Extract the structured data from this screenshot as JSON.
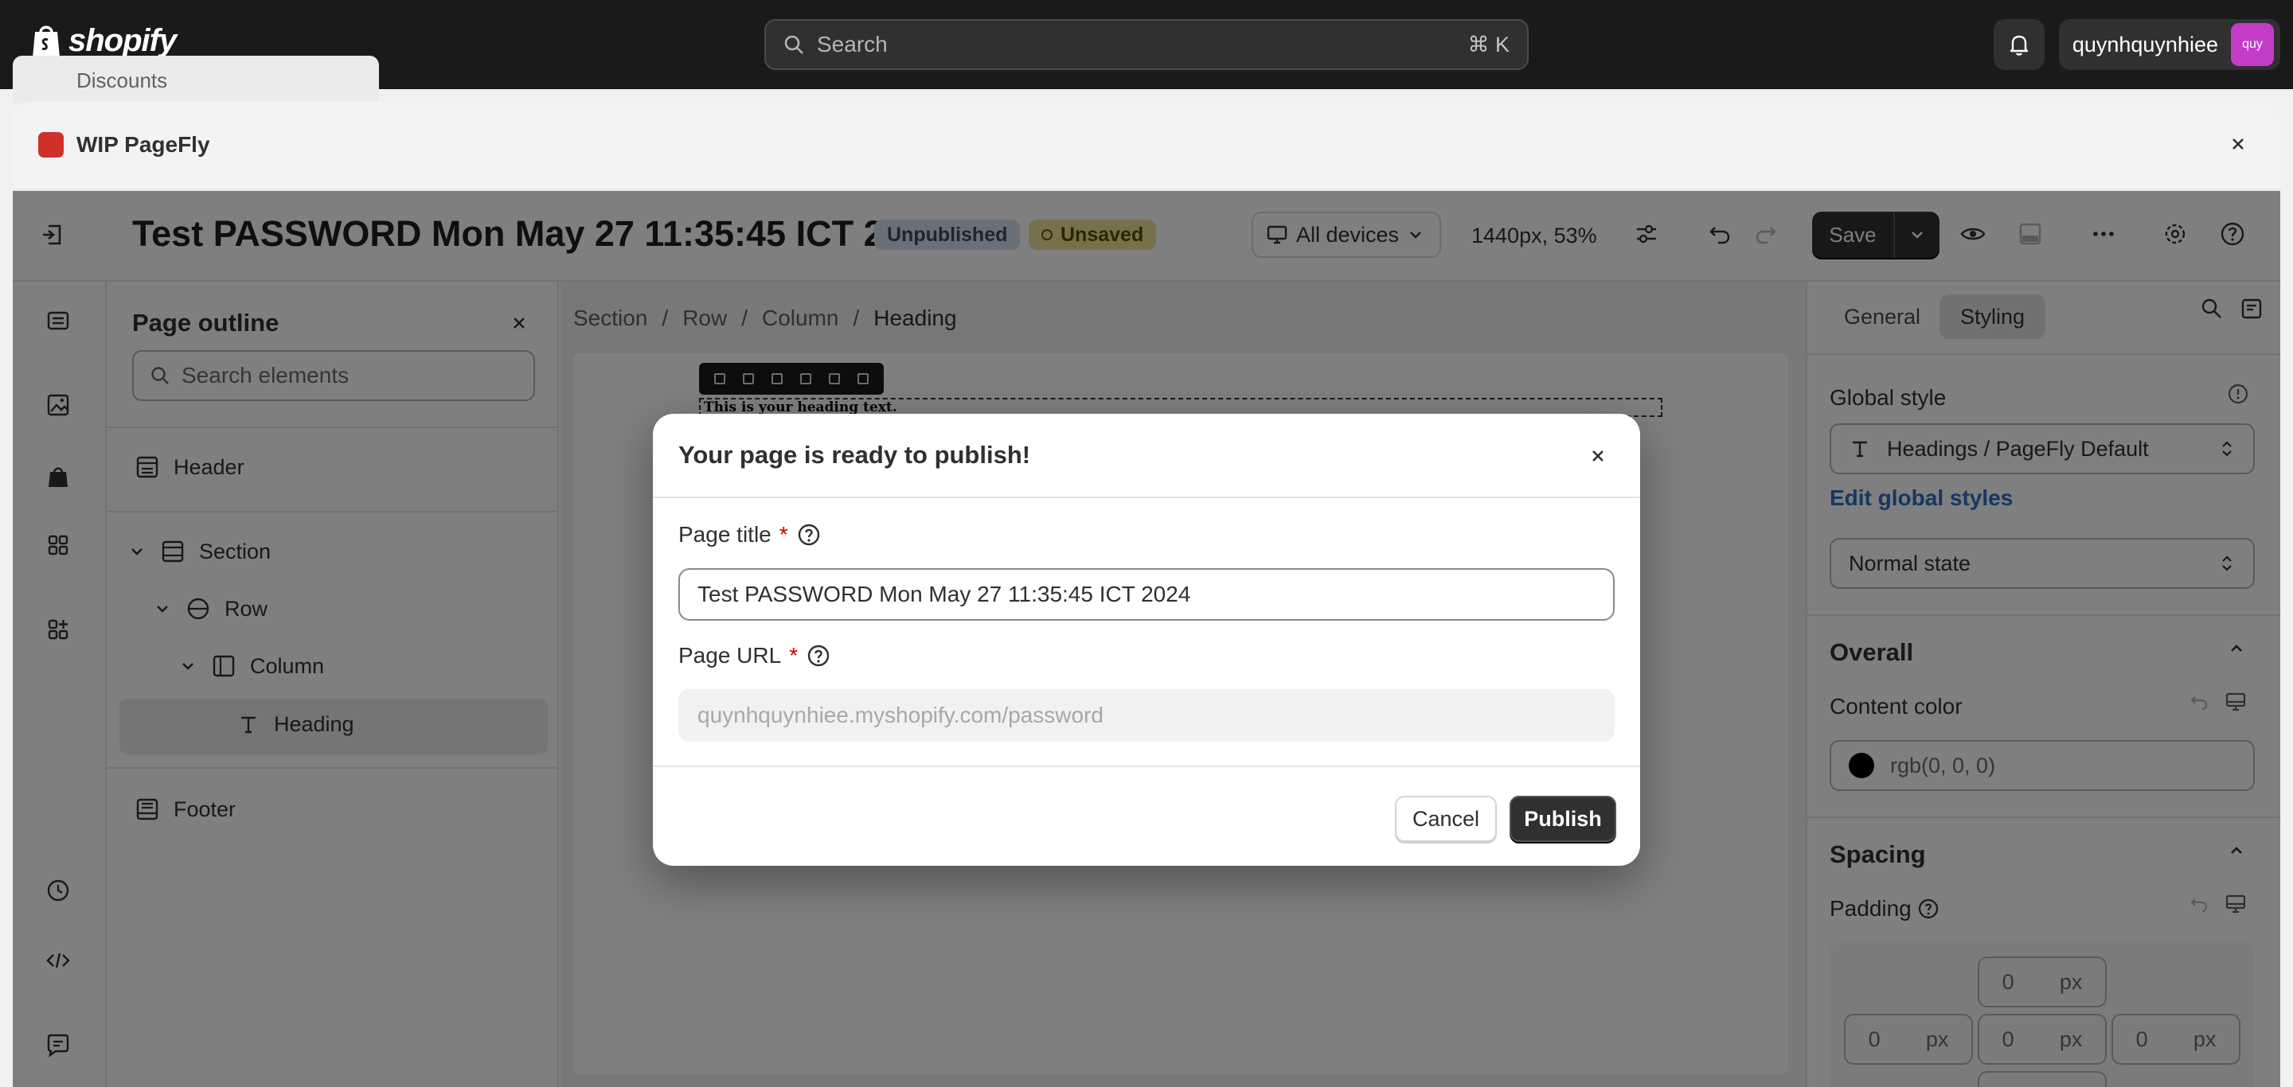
{
  "topbar": {
    "brand": "shopify",
    "search_placeholder": "Search",
    "search_shortcut": "⌘ K",
    "username": "quynhquynhiee",
    "avatar_initials": "quy"
  },
  "background_nav": {
    "item_label": "Discounts"
  },
  "app": {
    "title": "WIP PageFly"
  },
  "editor": {
    "page_title": "Test PASSWORD Mon May 27 11:35:45 ICT 20...",
    "status_unpublished": "Unpublished",
    "status_unsaved": "Unsaved",
    "device_select": "All devices",
    "zoom_readout": "1440px, 53%",
    "save_label": "Save"
  },
  "outline": {
    "title": "Page outline",
    "search_placeholder": "Search elements",
    "items": [
      {
        "label": "Header"
      },
      {
        "label": "Section"
      },
      {
        "label": "Row"
      },
      {
        "label": "Column"
      },
      {
        "label": "Heading"
      },
      {
        "label": "Footer"
      }
    ]
  },
  "breadcrumb": {
    "items": [
      "Section",
      "Row",
      "Column",
      "Heading"
    ],
    "separator": "/"
  },
  "canvas": {
    "heading_text": "This is your heading text."
  },
  "right_panel": {
    "tabs": [
      "General",
      "Styling"
    ],
    "active_tab": "Styling",
    "global_style_label": "Global style",
    "global_style_value": "Headings / PageFly Default",
    "edit_global_styles": "Edit global styles",
    "state_value": "Normal state",
    "overall_label": "Overall",
    "content_color_label": "Content color",
    "content_color_value": "rgb(0, 0, 0)",
    "spacing_label": "Spacing",
    "padding_label": "Padding",
    "padding_top": "0",
    "padding_left": "0",
    "padding_center": "0",
    "padding_right": "0",
    "unit": "px"
  },
  "modal": {
    "title": "Your page is ready to publish!",
    "page_title_label": "Page title",
    "page_title_value": "Test PASSWORD Mon May 27 11:35:45 ICT 2024",
    "page_url_label": "Page URL",
    "page_url_placeholder": "quynhquynhiee.myshopify.com/password",
    "required_mark": "*",
    "cancel_label": "Cancel",
    "publish_label": "Publish"
  },
  "colors": {
    "topbar": "#1a1a1a",
    "primary_button": "#303030",
    "link": "#2c6ecb",
    "badge_unpublished": "#d5e0ee",
    "badge_unsaved": "#f0e19a"
  }
}
